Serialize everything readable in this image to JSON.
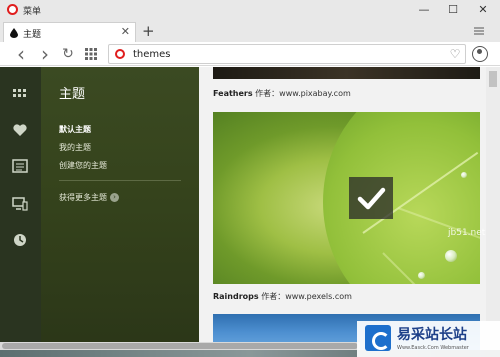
{
  "titlebar": {
    "menu_label": "菜单",
    "minimize": "—",
    "maximize": "☐",
    "close": "✕"
  },
  "tabs": [
    {
      "label": "主题",
      "close": "✕"
    }
  ],
  "tabbar": {
    "new_tab": "+"
  },
  "toolbar": {
    "back": "‹",
    "forward": "›",
    "reload": "↻",
    "url": "themes",
    "bookmark": "♡"
  },
  "sidebar": {
    "icons": [
      "speed-dial-icon",
      "heart-icon",
      "news-icon",
      "devices-icon",
      "history-icon"
    ],
    "title": "主题",
    "items": [
      {
        "label": "默认主题",
        "active": true
      },
      {
        "label": "我的主题",
        "active": false
      },
      {
        "label": "创建您的主题",
        "active": false
      }
    ],
    "more_label": "获得更多主题"
  },
  "themes": [
    {
      "name": "Feathers",
      "author_label": "作者：",
      "source": "www.pixabay.com"
    },
    {
      "name": "Raindrops",
      "author_label": "作者：",
      "source": "www.pexels.com",
      "selected": true
    }
  ],
  "watermark": {
    "url_fragment": "jb51.net",
    "title": "易采站长站",
    "subtitle": "Www.Easck.Com Webmaster"
  },
  "colors": {
    "opera_red": "#e01d1d",
    "sidebar_bg": "#35431c",
    "icon_strip_bg": "#2a3420"
  }
}
